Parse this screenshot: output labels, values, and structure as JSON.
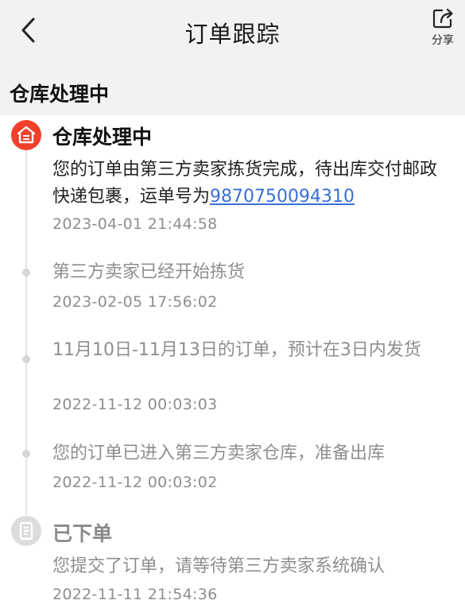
{
  "nav": {
    "title": "订单跟踪",
    "share_label": "分享",
    "back_icon": "chevron-left-icon",
    "share_icon": "share-export-icon"
  },
  "status_heading": "仓库处理中",
  "colors": {
    "accent": "#f0402a",
    "link": "#3a6fd8",
    "muted_text": "#8e8e8e"
  },
  "timeline": {
    "current": {
      "title": "仓库处理中",
      "desc_prefix": "您的订单由第三方卖家拣货完成，待出库交付邮政快递包裹，运单号为",
      "tracking_number": "9870750094310",
      "time": "2023-04-01 21:44:58",
      "icon": "warehouse-icon"
    },
    "events": [
      {
        "desc": "第三方卖家已经开始拣货",
        "time": "2023-02-05 17:56:02"
      },
      {
        "desc": "11月10日-11月13日的订单，预计在3日内发货",
        "time": "2022-11-12 00:03:03"
      },
      {
        "desc": "您的订单已进入第三方卖家仓库，准备出库",
        "time": "2022-11-12 00:03:02"
      }
    ],
    "placed": {
      "title": "已下单",
      "desc": "您提交了订单，请等待第三方卖家系统确认",
      "time": "2022-11-11 21:54:36",
      "icon": "order-document-icon"
    }
  }
}
